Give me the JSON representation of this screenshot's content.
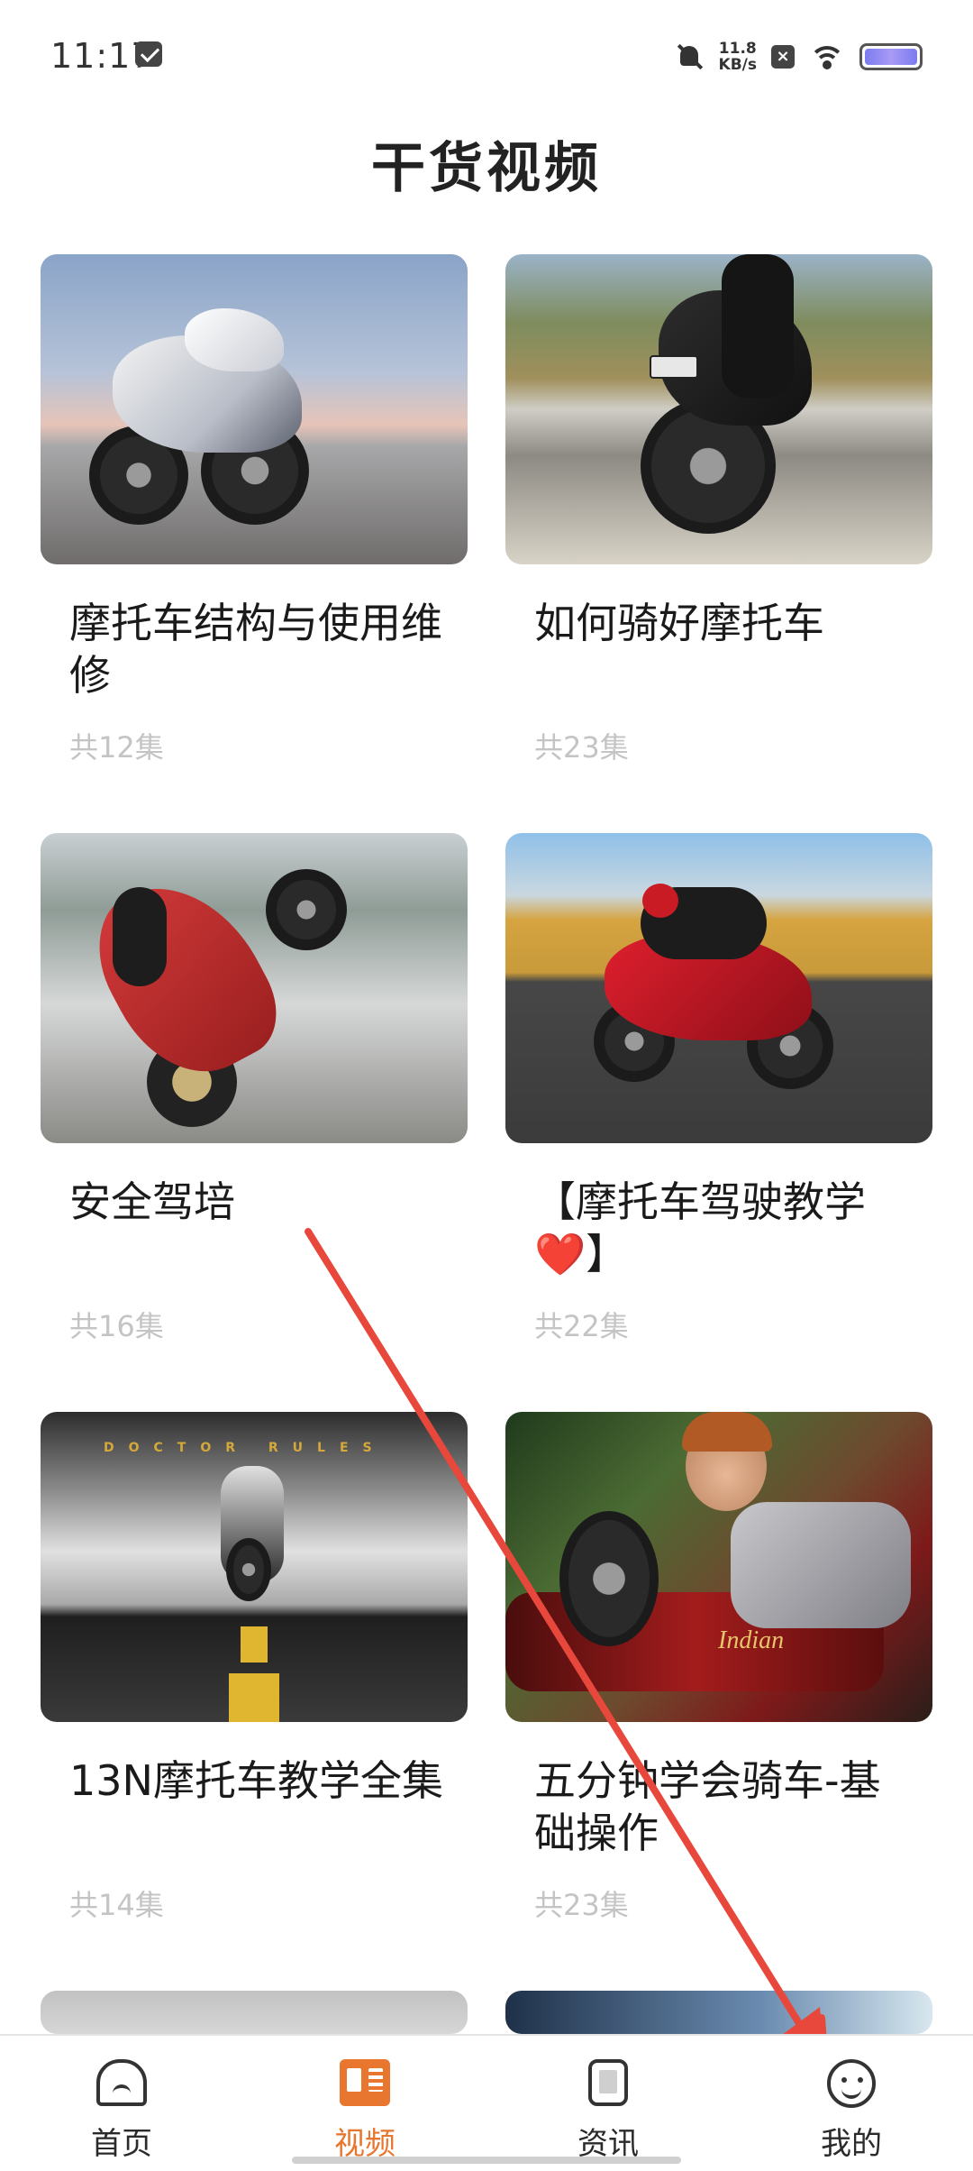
{
  "status_bar": {
    "time": "11:17",
    "net_speed_value": "11.8",
    "net_speed_unit": "KB/s"
  },
  "page": {
    "title": "干货视频"
  },
  "videos": [
    {
      "title": "摩托车结构与使用维修",
      "count": "共12集"
    },
    {
      "title": "如何骑好摩托车",
      "count": "共23集"
    },
    {
      "title": "安全驾培",
      "count": "共16集"
    },
    {
      "title": "【摩托车驾驶教学❤️】",
      "count": "共22集"
    },
    {
      "title": "13N摩托车教学全集",
      "count": "共14集"
    },
    {
      "title": "五分钟学会骑车-基础操作",
      "count": "共23集"
    }
  ],
  "thumb_text": {
    "doctor_rules": "DOCTOR RULES",
    "indian": "Indian"
  },
  "bottom_nav": {
    "items": [
      {
        "label": "首页",
        "icon": "home-icon",
        "active": false
      },
      {
        "label": "视频",
        "icon": "book-icon",
        "active": true
      },
      {
        "label": "资讯",
        "icon": "phone-icon",
        "active": false
      },
      {
        "label": "我的",
        "icon": "smile-icon",
        "active": false
      }
    ]
  },
  "colors": {
    "accent": "#e8762e",
    "count_text": "#c4c4c4",
    "annotation_arrow": "#e8483b"
  }
}
